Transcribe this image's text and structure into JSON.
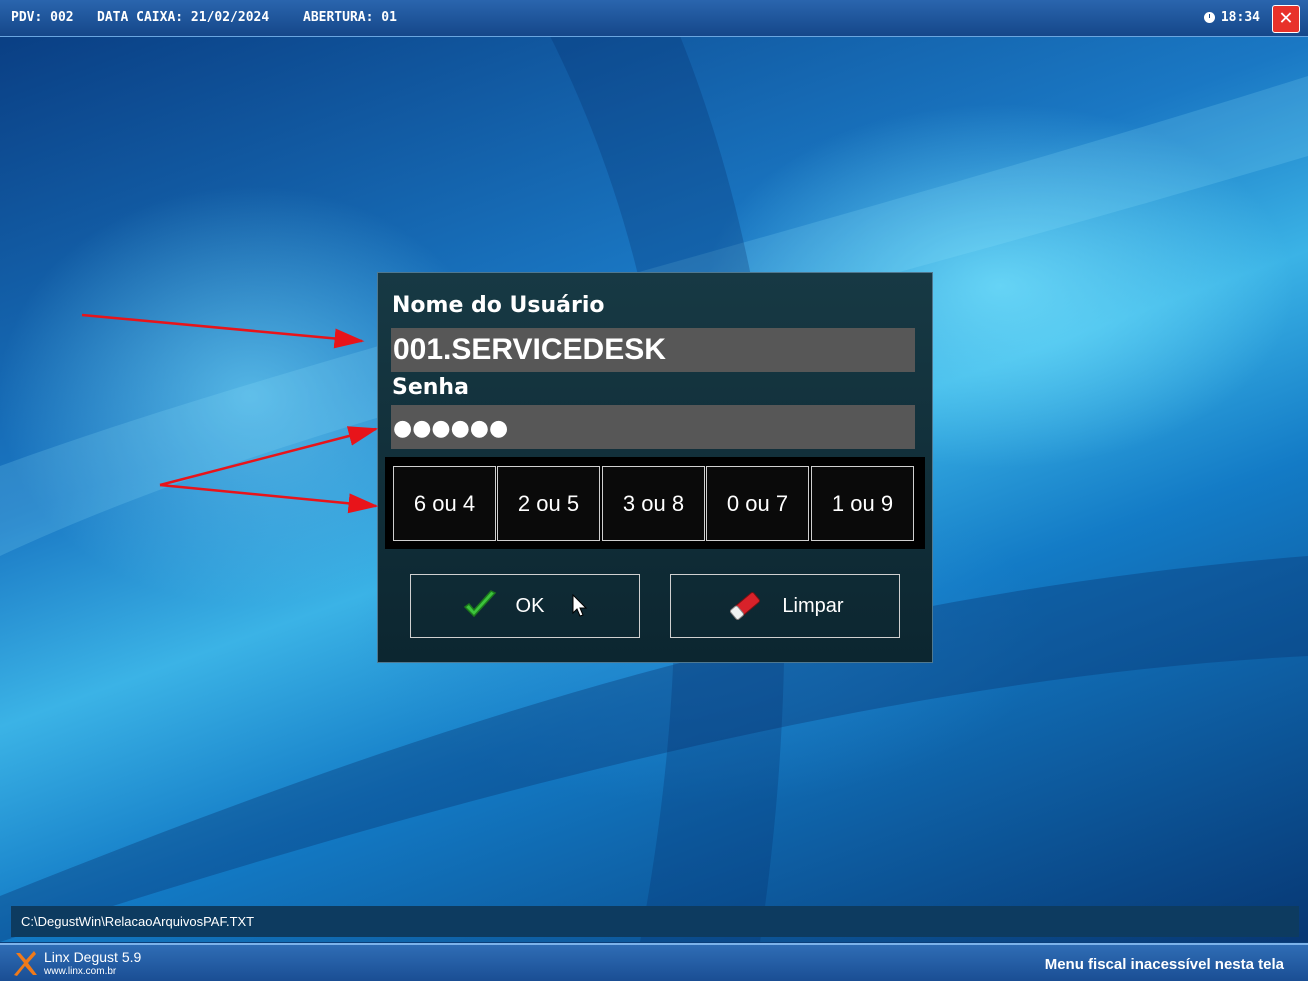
{
  "top_bar": {
    "pdv": "PDV: 002",
    "data_caixa": "DATA CAIXA: 21/02/2024",
    "abertura": "ABERTURA: 01",
    "time": "18:34",
    "close_icon": "close-icon"
  },
  "login": {
    "user_label": "Nome do Usuário",
    "user_value": "001.SERVICEDESK",
    "password_label": "Senha",
    "password_value": "●●●●●●",
    "keypad": [
      "6 ou 4",
      "2 ou 5",
      "3 ou 8",
      "0 ou 7",
      "1 ou 9"
    ],
    "ok_label": "OK",
    "clear_label": "Limpar"
  },
  "status": {
    "path": "C:\\DegustWin\\RelacaoArquivosPAF.TXT"
  },
  "footer": {
    "brand_name": "Linx Degust 5.9",
    "brand_url": "www.linx.com.br",
    "notice": "Menu fiscal inacessível nesta tela"
  },
  "colors": {
    "annotation_arrow": "#e8141a",
    "close_button": "#e8322a",
    "field_background": "#575757"
  }
}
